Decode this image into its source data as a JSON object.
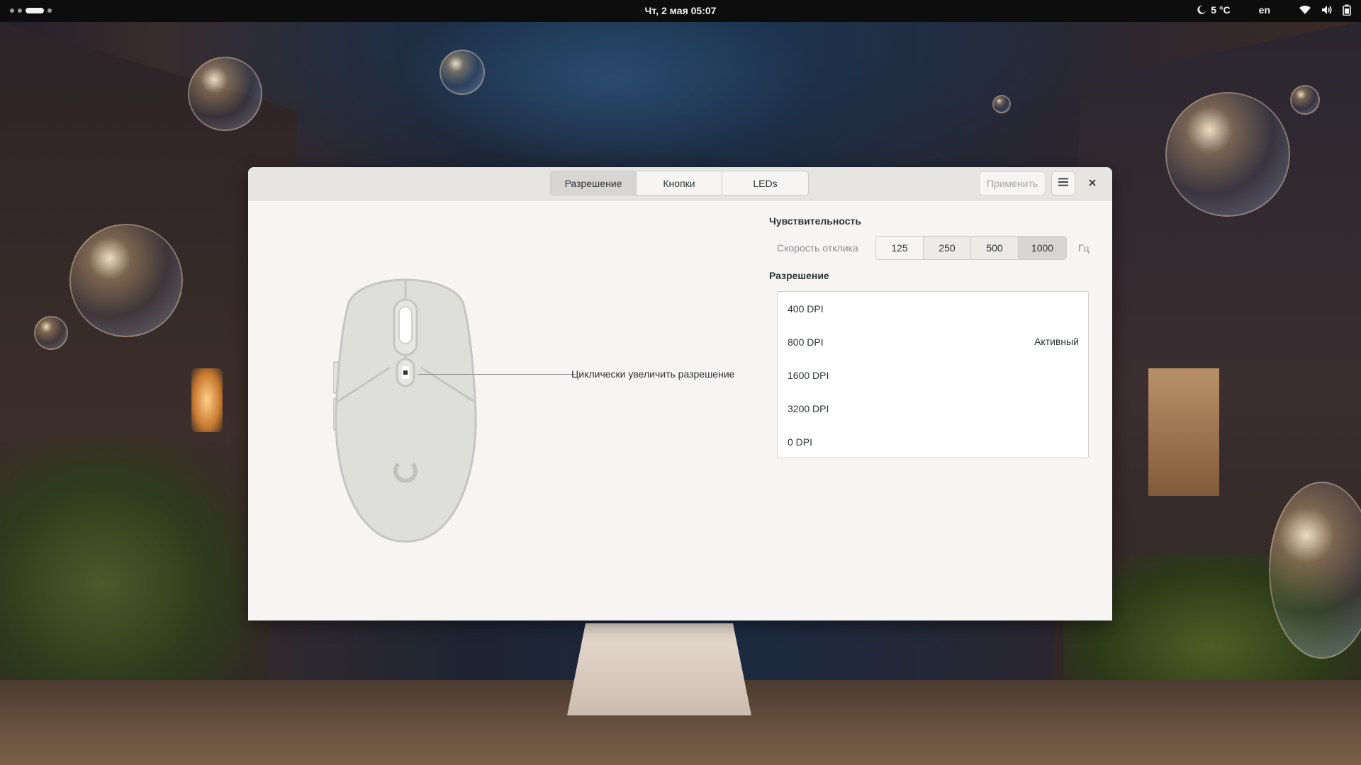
{
  "topbar": {
    "clock": "Чт, 2 мая  05:07",
    "weather": "5 °C",
    "weather_icon": "moon-icon",
    "lang": "en",
    "icons": [
      "wifi-icon",
      "volume-icon",
      "battery-icon"
    ]
  },
  "window": {
    "tabs": [
      {
        "label": "Разрешение",
        "active": true
      },
      {
        "label": "Кнопки",
        "active": false
      },
      {
        "label": "LEDs",
        "active": false
      }
    ],
    "apply_label": "Применить",
    "menu_icon": "hamburger-menu-icon",
    "close_icon": "close-icon"
  },
  "mouse": {
    "callout": "Циклически увеличить разрешение"
  },
  "sensitivity": {
    "title": "Чувствительность",
    "rate_label": "Скорость отклика",
    "rates": [
      "125",
      "250",
      "500",
      "1000"
    ],
    "selected_rate": "1000",
    "unit": "Гц"
  },
  "resolution": {
    "title": "Разрешение",
    "items": [
      {
        "label": "400 DPI",
        "status": ""
      },
      {
        "label": "800 DPI",
        "status": "Активный"
      },
      {
        "label": "1600 DPI",
        "status": ""
      },
      {
        "label": "3200 DPI",
        "status": ""
      },
      {
        "label": "0 DPI",
        "status": ""
      }
    ]
  },
  "colors": {
    "window_bg": "#f6f5f4",
    "headerbar_bg": "#e7e5e2",
    "text": "#2e3436",
    "dim_text": "#8b8e8f",
    "mouse_body": "#dededa"
  }
}
